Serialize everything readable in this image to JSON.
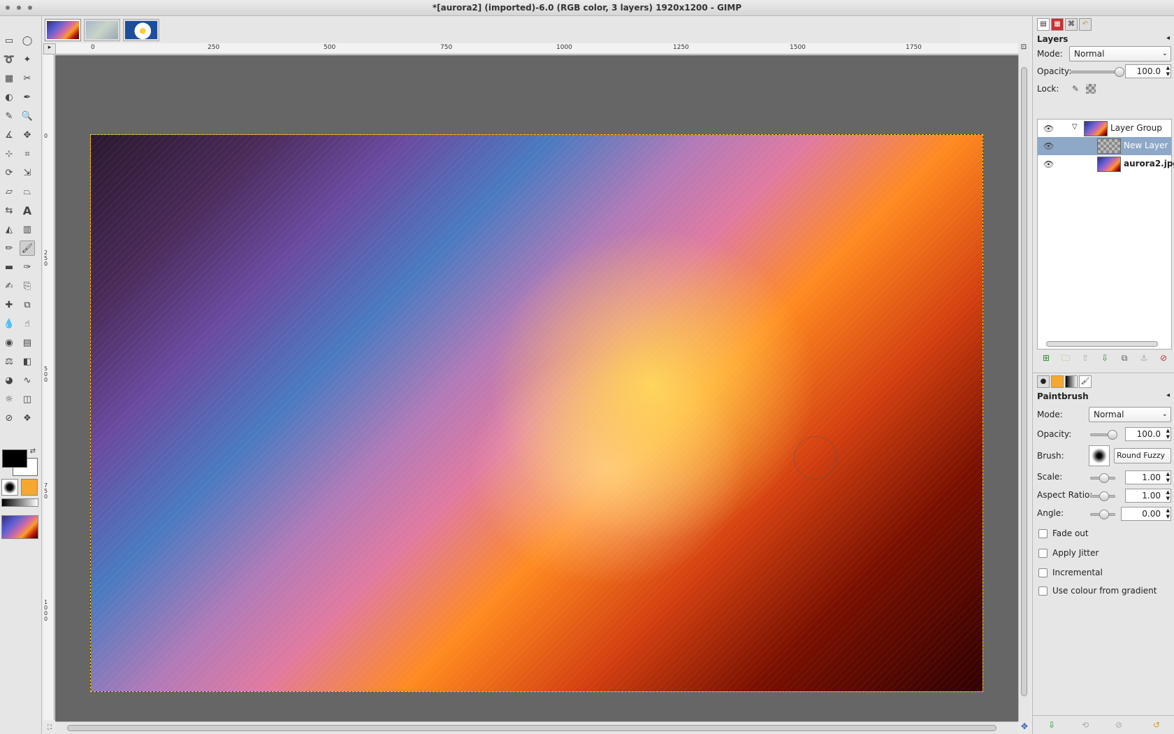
{
  "window": {
    "title": "*[aurora2] (imported)-6.0 (RGB color, 3 layers) 1920x1200 - GIMP"
  },
  "rulers": {
    "h_labels": [
      "0",
      "250",
      "500",
      "750",
      "1000",
      "1250",
      "1500",
      "1750"
    ],
    "v_labels": [
      "0",
      "250",
      "500",
      "750",
      "1000"
    ]
  },
  "layers_panel": {
    "title": "Layers",
    "mode_label": "Mode:",
    "mode_value": "Normal",
    "opacity_label": "Opacity:",
    "opacity_value": "100.0",
    "lock_label": "Lock:",
    "layers": [
      {
        "name": "Layer Group",
        "thumb": "aurora",
        "selected": false
      },
      {
        "name": "New Layer",
        "thumb": "transparent",
        "selected": true
      },
      {
        "name": "aurora2.jpg",
        "thumb": "aurora",
        "selected": false
      }
    ]
  },
  "tool_options": {
    "title": "Paintbrush",
    "mode_label": "Mode:",
    "mode_value": "Normal",
    "opacity_label": "Opacity:",
    "opacity_value": "100.0",
    "brush_label": "Brush:",
    "brush_value": "Round Fuzzy",
    "scale_label": "Scale:",
    "scale_value": "1.00",
    "aspect_label": "Aspect Ratio:",
    "aspect_value": "1.00",
    "angle_label": "Angle:",
    "angle_value": "0.00",
    "checkboxes": [
      "Fade out",
      "Apply Jitter",
      "Incremental",
      "Use colour from gradient"
    ]
  },
  "tools": {
    "text_tool_glyph": "A"
  },
  "colors": {
    "foreground": "#000000",
    "background": "#ffffff",
    "selection": "#8ea8c8"
  }
}
